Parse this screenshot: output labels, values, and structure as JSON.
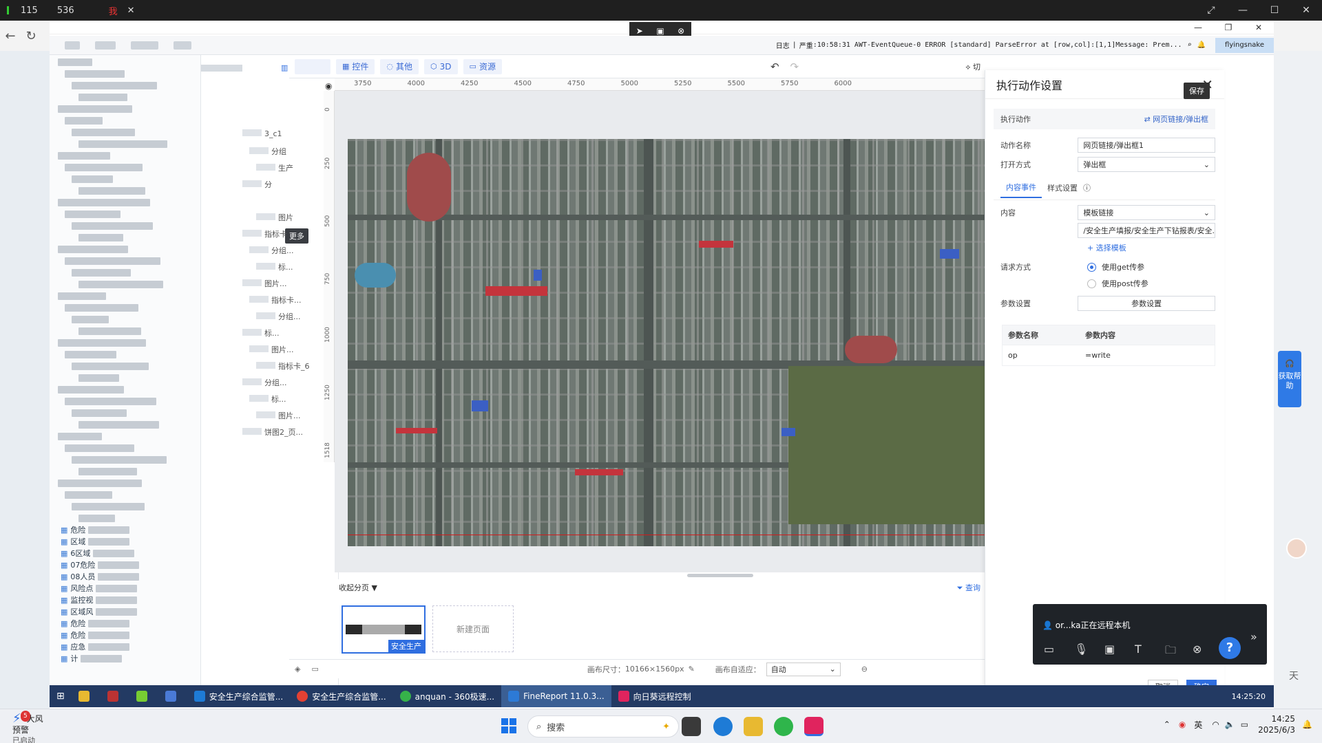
{
  "outer_browser": {
    "tab_text": "115",
    "tab_count": "536",
    "tab_label_red": "我",
    "nav_icons": [
      "back-icon",
      "refresh-icon"
    ]
  },
  "remote": {
    "rd_bar_icons": [
      "pointer-icon",
      "screen-icon",
      "close-circle-icon"
    ],
    "log": {
      "label": "日志",
      "severity": "严重",
      "message": "10:58:31 AWT-EventQueue-0 ERROR [standard] ParseError at [row,col]:[1,1]Message: Prem...",
      "user": "flyingsnake"
    },
    "toolbar": {
      "buttons": [
        {
          "icon": "▦",
          "label": "控件"
        },
        {
          "icon": "◌",
          "label": "其他"
        },
        {
          "icon": "⬡",
          "label": "3D"
        },
        {
          "icon": "▭",
          "label": "资源"
        }
      ],
      "switch_label": "切"
    },
    "ruler_top": [
      "3750",
      "4000",
      "4250",
      "4500",
      "4750",
      "5000",
      "5250",
      "5500",
      "5750",
      "6000"
    ],
    "ruler_left": [
      "0",
      "250",
      "500",
      "750",
      "1000",
      "1250",
      "1518"
    ],
    "component_tree": {
      "items": [
        "3_c1",
        "分组",
        "生产",
        "分",
        "更多",
        "图片",
        "指标卡",
        "分组...",
        "标...",
        "图片...",
        "指标卡...",
        "分组...",
        "标...",
        "图片...",
        "指标卡_6",
        "分组...",
        "标...",
        "图片...",
        "饼图2_页..."
      ],
      "more_tip": "更多"
    },
    "left_tree": {
      "items": [
        "危险",
        "区域",
        "6区域",
        "07危险",
        "08人员",
        "风险点",
        "监控视",
        "区域风",
        "危险",
        "危险",
        "应急",
        "计"
      ]
    },
    "pages": {
      "collapse_label": "收起分页",
      "query_label": "查询",
      "page1_label": "安全生产",
      "new_page_label": "新建页面"
    },
    "status": {
      "canvas_size_label": "画布尺寸：",
      "canvas_size": "10166×1560px",
      "adaptive_label": "画布自适应：",
      "adaptive_value": "自动"
    },
    "dialog": {
      "title": "执行动作设置",
      "save_tip": "保存",
      "action_header": "执行动作",
      "action_type": "⇄ 网页链接/弹出框",
      "name_label": "动作名称",
      "name_value": "网页链接/弹出框1",
      "open_label": "打开方式",
      "open_value": "弹出框",
      "tab_content": "内容事件",
      "tab_style": "样式设置",
      "content_label": "内容",
      "content_value": "模板链接",
      "path_value": "/安全生产填报/安全生产下钻报表/安全...",
      "choose_template": "+ 选择模板",
      "request_label": "请求方式",
      "get_label": "使用get传参",
      "post_label": "使用post传参",
      "param_label": "参数设置",
      "param_button": "参数设置",
      "table_headers": [
        "参数名称",
        "参数内容"
      ],
      "table_rows": [
        [
          "op",
          "=write"
        ]
      ],
      "cancel": "取消",
      "confirm": "确定"
    },
    "remote_control": {
      "who": "or...ka正在远程本机",
      "icons": [
        "chat-icon",
        "mic-icon",
        "screen-share-icon",
        "text-icon",
        "folder-icon",
        "close-circle-icon"
      ],
      "help": "?"
    },
    "help_float": "获取帮助",
    "taskbar": {
      "items": [
        {
          "label": "安全生产综合监管...",
          "color": "#1e7bd6"
        },
        {
          "label": "安全生产综合监管...",
          "color": "#e34133"
        },
        {
          "label": "anquan - 360极速...",
          "color": "#36b24a"
        },
        {
          "label": "FineReport 11.0.3...",
          "color": "#2d7ad6",
          "active": true
        },
        {
          "label": "向日葵远程控制",
          "color": "#e0245e"
        }
      ],
      "clock": "14:25:20"
    }
  },
  "outer_taskbar": {
    "weather_title": "大风预警",
    "weather_sub": "已启动",
    "weather_badge": "5",
    "search_placeholder": "搜索",
    "ime": "英",
    "time": "14:25",
    "date": "2025/6/3",
    "side_char": "天"
  }
}
